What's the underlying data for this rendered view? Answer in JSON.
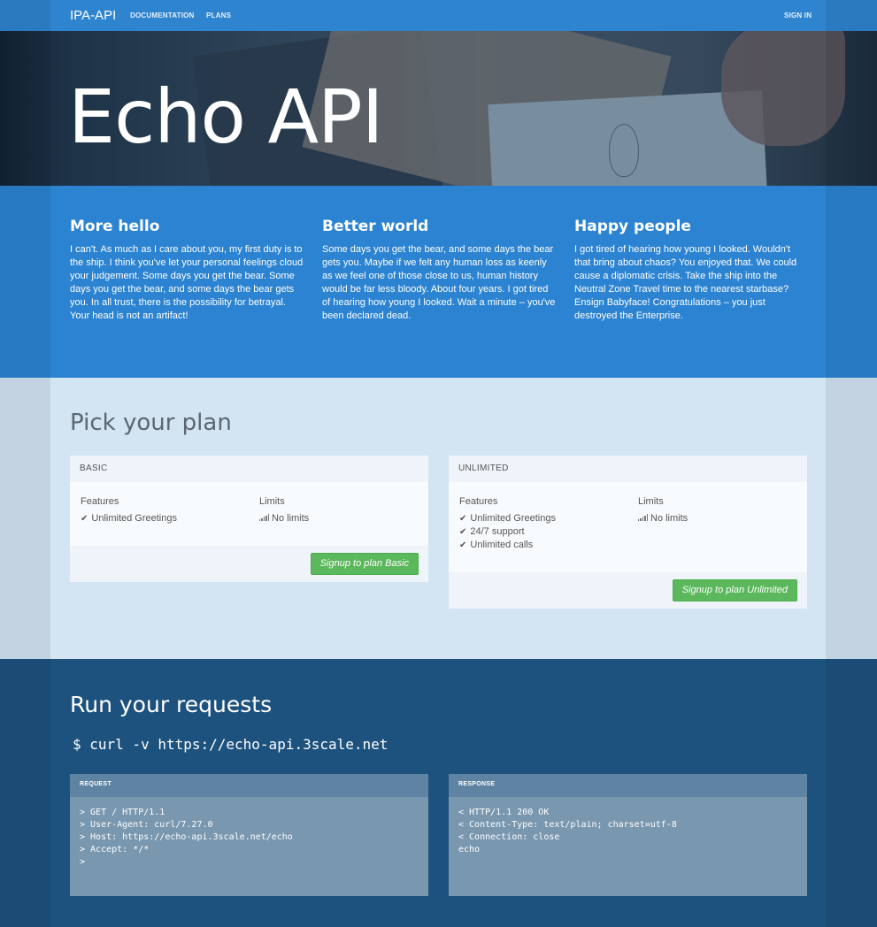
{
  "navbar": {
    "brand": "IPA-API",
    "links": [
      "DOCUMENTATION",
      "PLANS"
    ],
    "signin": "SIGN IN"
  },
  "hero": {
    "title": "Echo API"
  },
  "intro": [
    {
      "heading": "More hello",
      "text": "I can't. As much as I care about you, my first duty is to the ship. I think you've let your personal feelings cloud your judgement. Some days you get the bear. Some days you get the bear, and some days the bear gets you. In all trust, there is the possibility for betrayal. Your head is not an artifact!"
    },
    {
      "heading": "Better world",
      "text": "Some days you get the bear, and some days the bear gets you. Maybe if we felt any human loss as keenly as we feel one of those close to us, human history would be far less bloody. About four years. I got tired of hearing how young I looked. Wait a minute – you've been declared dead."
    },
    {
      "heading": "Happy people",
      "text": "I got tired of hearing how young I looked. Wouldn't that bring about chaos? You enjoyed that. We could cause a diplomatic crisis. Take the ship into the Neutral Zone Travel time to the nearest starbase? Ensign Babyface! Congratulations – you just destroyed the Enterprise."
    }
  ],
  "plans": {
    "title": "Pick your plan",
    "features_label": "Features",
    "limits_label": "Limits",
    "basic": {
      "name": "BASIC",
      "features": [
        "Unlimited Greetings"
      ],
      "limit": "No limits",
      "button": "Signup to plan Basic"
    },
    "unlimited": {
      "name": "UNLIMITED",
      "features": [
        "Unlimited Greetings",
        "24/7 support",
        "Unlimited calls"
      ],
      "limit": "No limits",
      "button": "Signup to plan Unlimited"
    }
  },
  "requests": {
    "title": "Run your requests",
    "command": "$ curl -v https://echo-api.3scale.net",
    "request": {
      "label": "REQUEST",
      "lines": [
        "> GET / HTTP/1.1",
        "> User-Agent: curl/7.27.0",
        "> Host: https://echo-api.3scale.net/echo",
        "> Accept: */*",
        ">"
      ]
    },
    "response": {
      "label": "RESPONSE",
      "lines": [
        "< HTTP/1.1 200 OK",
        "< Content-Type: text/plain; charset=utf-8",
        "< Connection: close",
        "echo"
      ]
    }
  },
  "colors": {
    "navbar": "#2f84cf",
    "intro": "#2b83d1",
    "plans_bg": "#d3e4f3",
    "requests_bg": "#1d527f",
    "signup_button": "#5cb85c"
  },
  "icons": {
    "feature": "check-icon",
    "limit": "signal-bars-icon"
  }
}
